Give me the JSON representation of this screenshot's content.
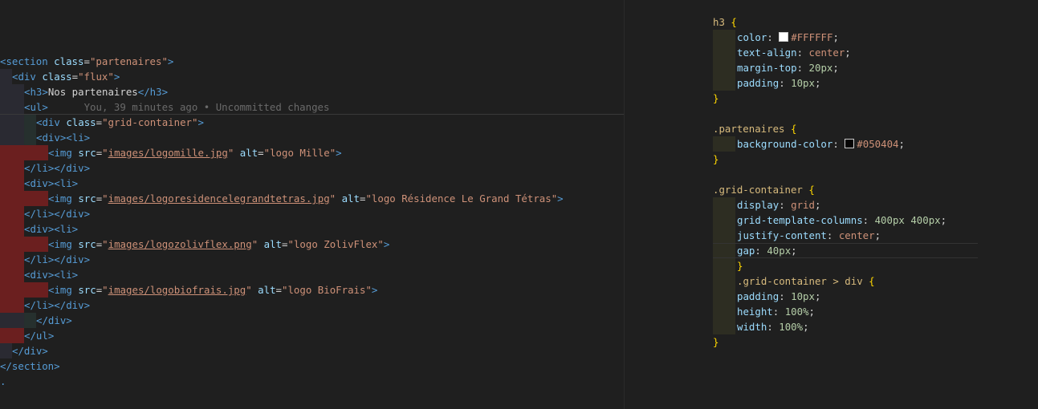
{
  "html_editor": {
    "blame_annotation": "You, 39 minutes ago • Uncommitted changes",
    "lines": [
      {
        "row": 0,
        "guides": 0,
        "hl": "none",
        "tokens": [
          [
            "tag",
            "<section"
          ],
          [
            "text",
            " "
          ],
          [
            "attr",
            "class"
          ],
          [
            "text",
            "="
          ],
          [
            "str",
            "\"partenaires\""
          ],
          [
            "tag",
            ">"
          ]
        ]
      },
      {
        "row": 1,
        "guides": 1,
        "hl": "none",
        "tokens": [
          [
            "tag",
            "<div"
          ],
          [
            "text",
            " "
          ],
          [
            "attr",
            "class"
          ],
          [
            "text",
            "="
          ],
          [
            "str",
            "\"flux\""
          ],
          [
            "tag",
            ">"
          ]
        ]
      },
      {
        "row": 2,
        "guides": 2,
        "hl": "none",
        "tokens": [
          [
            "tag",
            "<h3>"
          ],
          [
            "text",
            "Nos partenaires"
          ],
          [
            "tag",
            "</h3>"
          ]
        ]
      },
      {
        "row": 3,
        "guides": 2,
        "hl": "none",
        "tokens": [
          [
            "tag",
            "<ul>"
          ]
        ],
        "blame": true
      },
      {
        "row": 4,
        "guides": 3,
        "hl": "none",
        "tokens": [
          [
            "tag",
            "<div"
          ],
          [
            "text",
            " "
          ],
          [
            "attr",
            "class"
          ],
          [
            "text",
            "="
          ],
          [
            "str",
            "\"grid-container\""
          ],
          [
            "tag",
            ">"
          ]
        ]
      },
      {
        "row": 5,
        "guides": 3,
        "hl": "none",
        "tokens": [
          [
            "tag",
            "<div><li>"
          ]
        ]
      },
      {
        "row": 6,
        "guides": 4,
        "hl": "red",
        "tokens": [
          [
            "tag",
            "<img"
          ],
          [
            "text",
            " "
          ],
          [
            "attr",
            "src"
          ],
          [
            "text",
            "="
          ],
          [
            "str",
            "\""
          ],
          [
            "url",
            "images/logomille.jpg"
          ],
          [
            "str",
            "\""
          ],
          [
            "text",
            " "
          ],
          [
            "attr",
            "alt"
          ],
          [
            "text",
            "="
          ],
          [
            "str",
            "\"logo Mille\""
          ],
          [
            "tag",
            ">"
          ]
        ]
      },
      {
        "row": 7,
        "guides": 2,
        "hl": "red",
        "tokens": [
          [
            "tag",
            "</li></div>"
          ]
        ]
      },
      {
        "row": 8,
        "guides": 2,
        "hl": "red",
        "tokens": [
          [
            "tag",
            "<div><li>"
          ]
        ]
      },
      {
        "row": 9,
        "guides": 4,
        "hl": "red",
        "tokens": [
          [
            "tag",
            "<img"
          ],
          [
            "text",
            " "
          ],
          [
            "attr",
            "src"
          ],
          [
            "text",
            "="
          ],
          [
            "str",
            "\""
          ],
          [
            "url",
            "images/logoresidencelegrandtetras.jpg"
          ],
          [
            "str",
            "\""
          ],
          [
            "text",
            " "
          ],
          [
            "attr",
            "alt"
          ],
          [
            "text",
            "="
          ],
          [
            "str",
            "\"logo Résidence Le Grand Tétras\""
          ],
          [
            "tag",
            ">"
          ]
        ]
      },
      {
        "row": 10,
        "guides": 2,
        "hl": "red",
        "tokens": [
          [
            "tag",
            "</li></div>"
          ]
        ]
      },
      {
        "row": 11,
        "guides": 2,
        "hl": "red",
        "tokens": [
          [
            "tag",
            "<div><li>"
          ]
        ]
      },
      {
        "row": 12,
        "guides": 4,
        "hl": "red",
        "tokens": [
          [
            "tag",
            "<img"
          ],
          [
            "text",
            " "
          ],
          [
            "attr",
            "src"
          ],
          [
            "text",
            "="
          ],
          [
            "str",
            "\""
          ],
          [
            "url",
            "images/logozolivflex.png"
          ],
          [
            "str",
            "\""
          ],
          [
            "text",
            " "
          ],
          [
            "attr",
            "alt"
          ],
          [
            "text",
            "="
          ],
          [
            "str",
            "\"logo ZolivFlex\""
          ],
          [
            "tag",
            ">"
          ]
        ]
      },
      {
        "row": 13,
        "guides": 2,
        "hl": "red",
        "tokens": [
          [
            "tag",
            "</li></div>"
          ]
        ]
      },
      {
        "row": 14,
        "guides": 2,
        "hl": "red",
        "tokens": [
          [
            "tag",
            "<div><li>"
          ]
        ]
      },
      {
        "row": 15,
        "guides": 4,
        "hl": "red",
        "tokens": [
          [
            "tag",
            "<img"
          ],
          [
            "text",
            " "
          ],
          [
            "attr",
            "src"
          ],
          [
            "text",
            "="
          ],
          [
            "str",
            "\""
          ],
          [
            "url",
            "images/logobiofrais.jpg"
          ],
          [
            "str",
            "\""
          ],
          [
            "text",
            " "
          ],
          [
            "attr",
            "alt"
          ],
          [
            "text",
            "="
          ],
          [
            "str",
            "\"logo BioFrais\""
          ],
          [
            "tag",
            ">"
          ]
        ]
      },
      {
        "row": 16,
        "guides": 2,
        "hl": "red",
        "tokens": [
          [
            "tag",
            "</li></div>"
          ]
        ]
      },
      {
        "row": 17,
        "guides": 3,
        "hl": "mixed",
        "tokens": [
          [
            "tag",
            "</div>"
          ]
        ]
      },
      {
        "row": 18,
        "guides": 2,
        "hl": "red",
        "tokens": [
          [
            "tag",
            "</ul>"
          ]
        ]
      },
      {
        "row": 19,
        "guides": 1,
        "hl": "none",
        "tokens": [
          [
            "tag",
            "</div>"
          ]
        ]
      },
      {
        "row": 20,
        "guides": 0,
        "hl": "none",
        "tokens": [
          [
            "tag",
            "</section>"
          ]
        ]
      },
      {
        "row": 21,
        "guides": 0,
        "hl": "none",
        "tokens": [
          [
            "tag",
            "."
          ]
        ]
      }
    ]
  },
  "css_editor": {
    "lines": [
      {
        "row": 0,
        "indent": 0,
        "tokens": [
          [
            "sel",
            "h3"
          ],
          [
            "punct",
            " "
          ],
          [
            "brace",
            "{"
          ]
        ]
      },
      {
        "row": 1,
        "indent": 1,
        "tokens": [
          [
            "prop",
            "color"
          ],
          [
            "punct",
            ": "
          ],
          [
            "swatch",
            "#FFFFFF"
          ],
          [
            "val",
            "#FFFFFF"
          ],
          [
            "punct",
            ";"
          ]
        ]
      },
      {
        "row": 2,
        "indent": 1,
        "tokens": [
          [
            "prop",
            "text-align"
          ],
          [
            "punct",
            ": "
          ],
          [
            "val",
            "center"
          ],
          [
            "punct",
            ";"
          ]
        ]
      },
      {
        "row": 3,
        "indent": 1,
        "tokens": [
          [
            "prop",
            "margin-top"
          ],
          [
            "punct",
            ": "
          ],
          [
            "num",
            "20px"
          ],
          [
            "punct",
            ";"
          ]
        ]
      },
      {
        "row": 4,
        "indent": 1,
        "tokens": [
          [
            "prop",
            "padding"
          ],
          [
            "punct",
            ": "
          ],
          [
            "num",
            "10px"
          ],
          [
            "punct",
            ";"
          ]
        ]
      },
      {
        "row": 5,
        "indent": 0,
        "tokens": [
          [
            "brace",
            "}"
          ]
        ]
      },
      {
        "row": 7,
        "indent": 0,
        "tokens": [
          [
            "sel",
            ".partenaires"
          ],
          [
            "punct",
            " "
          ],
          [
            "brace",
            "{"
          ]
        ]
      },
      {
        "row": 8,
        "indent": 1,
        "tokens": [
          [
            "prop",
            "background-color"
          ],
          [
            "punct",
            ": "
          ],
          [
            "swatch",
            "#050404"
          ],
          [
            "val",
            "#050404"
          ],
          [
            "punct",
            ";"
          ]
        ]
      },
      {
        "row": 9,
        "indent": 0,
        "tokens": [
          [
            "brace",
            "}"
          ]
        ]
      },
      {
        "row": 11,
        "indent": 0,
        "tokens": [
          [
            "sel",
            ".grid-container"
          ],
          [
            "punct",
            " "
          ],
          [
            "brace",
            "{"
          ]
        ]
      },
      {
        "row": 12,
        "indent": 1,
        "tokens": [
          [
            "prop",
            "display"
          ],
          [
            "punct",
            ": "
          ],
          [
            "val",
            "grid"
          ],
          [
            "punct",
            ";"
          ]
        ]
      },
      {
        "row": 13,
        "indent": 1,
        "tokens": [
          [
            "prop",
            "grid-template-columns"
          ],
          [
            "punct",
            ": "
          ],
          [
            "num",
            "400px 400px"
          ],
          [
            "punct",
            ";"
          ]
        ]
      },
      {
        "row": 14,
        "indent": 1,
        "tokens": [
          [
            "prop",
            "justify-content"
          ],
          [
            "punct",
            ": "
          ],
          [
            "val",
            "center"
          ],
          [
            "punct",
            ";"
          ]
        ]
      },
      {
        "row": 15,
        "indent": 1,
        "tokens": [
          [
            "prop",
            "gap"
          ],
          [
            "punct",
            ": "
          ],
          [
            "num",
            "40px"
          ],
          [
            "punct",
            ";"
          ]
        ],
        "current": true
      },
      {
        "row": 16,
        "indent": 1,
        "tokens": [
          [
            "brace",
            "}"
          ]
        ]
      },
      {
        "row": 17,
        "indent": 1,
        "tokens": [
          [
            "sel",
            ".grid-container > div"
          ],
          [
            "punct",
            " "
          ],
          [
            "brace",
            "{"
          ]
        ]
      },
      {
        "row": 18,
        "indent": 1,
        "tokens": [
          [
            "prop",
            "padding"
          ],
          [
            "punct",
            ": "
          ],
          [
            "num",
            "10px"
          ],
          [
            "punct",
            ";"
          ]
        ]
      },
      {
        "row": 19,
        "indent": 1,
        "tokens": [
          [
            "prop",
            "height"
          ],
          [
            "punct",
            ": "
          ],
          [
            "num",
            "100%"
          ],
          [
            "punct",
            ";"
          ]
        ]
      },
      {
        "row": 20,
        "indent": 1,
        "tokens": [
          [
            "prop",
            "width"
          ],
          [
            "punct",
            ": "
          ],
          [
            "num",
            "100%"
          ],
          [
            "punct",
            ";"
          ]
        ]
      },
      {
        "row": 21,
        "indent": 0,
        "tokens": [
          [
            "brace",
            "}"
          ]
        ]
      }
    ]
  },
  "colors": {
    "guide_dark": "#2a2a32",
    "guide_red": "#6b1f1f",
    "guide_teal": "#26302e",
    "guide_olive": "#2f2f1f",
    "css_indent_bg": "#2d2d22"
  }
}
